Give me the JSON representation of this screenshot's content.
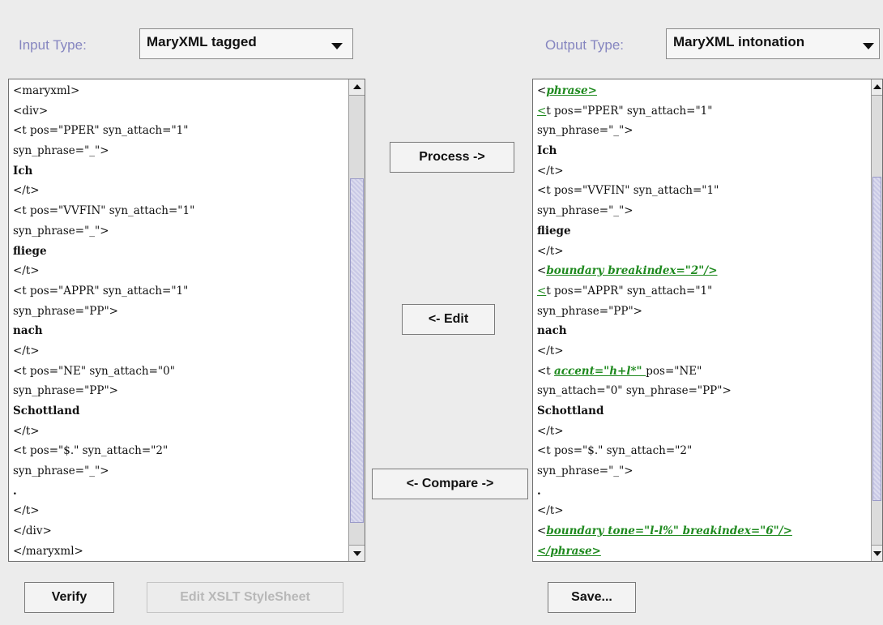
{
  "input": {
    "label": "Input Type:",
    "selected": "MaryXML tagged",
    "lines": [
      [
        {
          "t": "<maryxml>"
        }
      ],
      [
        {
          "t": "<div>"
        }
      ],
      [
        {
          "t": "<t pos=\"PPER\" syn_attach=\"1\""
        }
      ],
      [
        {
          "t": "syn_phrase=\"_\">"
        }
      ],
      [
        {
          "t": "Ich",
          "s": "bold"
        }
      ],
      [
        {
          "t": "</t>"
        }
      ],
      [
        {
          "t": "<t pos=\"VVFIN\" syn_attach=\"1\""
        }
      ],
      [
        {
          "t": "syn_phrase=\"_\">"
        }
      ],
      [
        {
          "t": "fliege",
          "s": "bold"
        }
      ],
      [
        {
          "t": "</t>"
        }
      ],
      [
        {
          "t": "<t pos=\"APPR\" syn_attach=\"1\""
        }
      ],
      [
        {
          "t": "syn_phrase=\"PP\">"
        }
      ],
      [
        {
          "t": "nach",
          "s": "bold"
        }
      ],
      [
        {
          "t": "</t>"
        }
      ],
      [
        {
          "t": "<t pos=\"NE\" syn_attach=\"0\""
        }
      ],
      [
        {
          "t": "syn_phrase=\"PP\">"
        }
      ],
      [
        {
          "t": "Schottland",
          "s": "bold"
        }
      ],
      [
        {
          "t": "</t>"
        }
      ],
      [
        {
          "t": "<t pos=\"$.\" syn_attach=\"2\""
        }
      ],
      [
        {
          "t": "syn_phrase=\"_\">"
        }
      ],
      [
        {
          "t": ".",
          "s": "bold"
        }
      ],
      [
        {
          "t": "</t>"
        }
      ],
      [
        {
          "t": "</div>"
        }
      ],
      [
        {
          "t": "</maryxml>"
        }
      ]
    ]
  },
  "output": {
    "label": "Output Type:",
    "selected": "MaryXML intonation",
    "lines": [
      [
        {
          "t": "<"
        },
        {
          "t": "phrase>",
          "s": "hl"
        }
      ],
      [
        {
          "t": "<",
          "s": "ul"
        },
        {
          "t": "t pos=\"PPER\" syn_attach=\"1\""
        }
      ],
      [
        {
          "t": "syn_phrase=\"_\">"
        }
      ],
      [
        {
          "t": "Ich",
          "s": "bold"
        }
      ],
      [
        {
          "t": "</t>"
        }
      ],
      [
        {
          "t": "<t pos=\"VVFIN\" syn_attach=\"1\""
        }
      ],
      [
        {
          "t": "syn_phrase=\"_\">"
        }
      ],
      [
        {
          "t": "fliege",
          "s": "bold"
        }
      ],
      [
        {
          "t": "</t>"
        }
      ],
      [
        {
          "t": "<"
        },
        {
          "t": "boundary breakindex=\"2\"/>",
          "s": "hl"
        }
      ],
      [
        {
          "t": "<",
          "s": "ul"
        },
        {
          "t": "t pos=\"APPR\" syn_attach=\"1\""
        }
      ],
      [
        {
          "t": "syn_phrase=\"PP\">"
        }
      ],
      [
        {
          "t": "nach",
          "s": "bold"
        }
      ],
      [
        {
          "t": "</t>"
        }
      ],
      [
        {
          "t": "<t "
        },
        {
          "t": "accent=\"h+l*\" ",
          "s": "hl"
        },
        {
          "t": "pos=\"NE\""
        }
      ],
      [
        {
          "t": "syn_attach=\"0\" syn_phrase=\"PP\">"
        }
      ],
      [
        {
          "t": "Schottland",
          "s": "bold"
        }
      ],
      [
        {
          "t": "</t>"
        }
      ],
      [
        {
          "t": "<t pos=\"$.\" syn_attach=\"2\""
        }
      ],
      [
        {
          "t": "syn_phrase=\"_\">"
        }
      ],
      [
        {
          "t": ".",
          "s": "bold"
        }
      ],
      [
        {
          "t": "</t>"
        }
      ],
      [
        {
          "t": "<"
        },
        {
          "t": "boundary tone=\"l-l%\" breakindex=\"6\"/>",
          "s": "hl"
        }
      ],
      [
        {
          "t": "</phrase>",
          "s": "hl"
        }
      ]
    ]
  },
  "buttons": {
    "process": "Process ->",
    "edit": "<- Edit",
    "compare": "<- Compare ->",
    "verify": "Verify",
    "edit_xslt": "Edit XSLT StyleSheet",
    "save": "Save..."
  }
}
